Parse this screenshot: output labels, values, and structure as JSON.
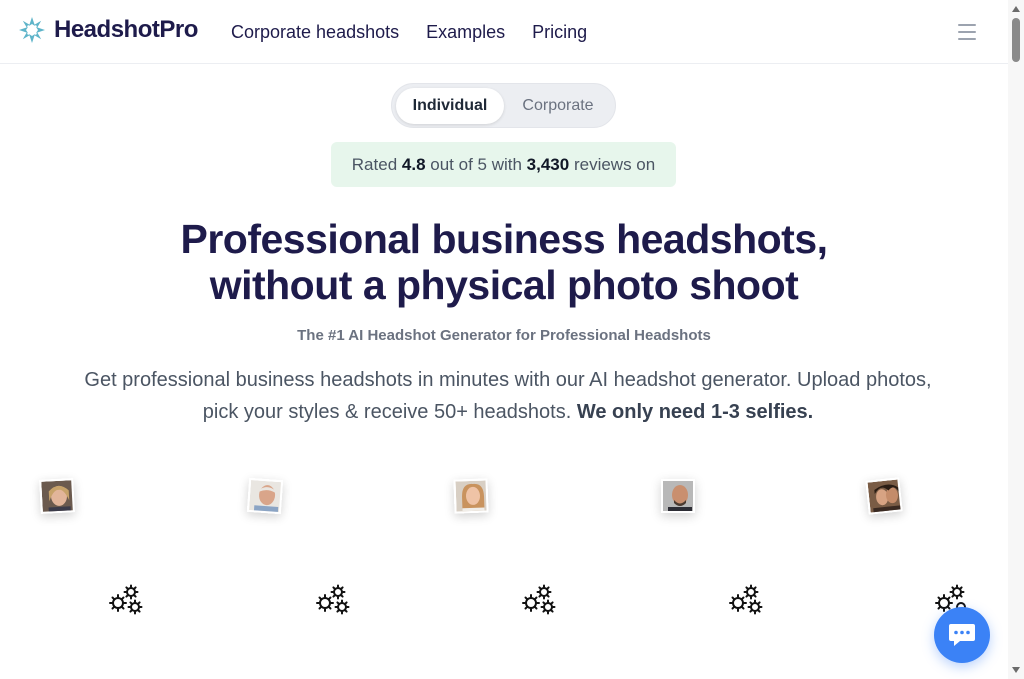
{
  "brand": {
    "name": "HeadshotPro",
    "accent": "#1e1b4b",
    "logo_color": "#5eb4c9"
  },
  "nav": {
    "items": [
      "Corporate headshots",
      "Examples",
      "Pricing"
    ]
  },
  "toggle": {
    "options": [
      "Individual",
      "Corporate"
    ],
    "selected": "Individual"
  },
  "rating": {
    "prefix": "Rated",
    "score": "4.8",
    "middle": "out of 5 with",
    "count": "3,430",
    "suffix": "reviews on"
  },
  "hero": {
    "title_line1": "Professional business headshots,",
    "title_line2": "without a physical photo shoot",
    "subtitle": "The #1 AI Headshot Generator for Professional Headshots",
    "desc_regular": "Get professional business headshots in minutes with our AI headshot generator. Upload photos, pick your styles & receive 50+ headshots.",
    "desc_bold": "We only need 1-3 selfies."
  },
  "icons": {
    "menu": "hamburger-menu-icon",
    "gears": "gears-loading-icon",
    "chat": "chat-bubble-icon"
  }
}
